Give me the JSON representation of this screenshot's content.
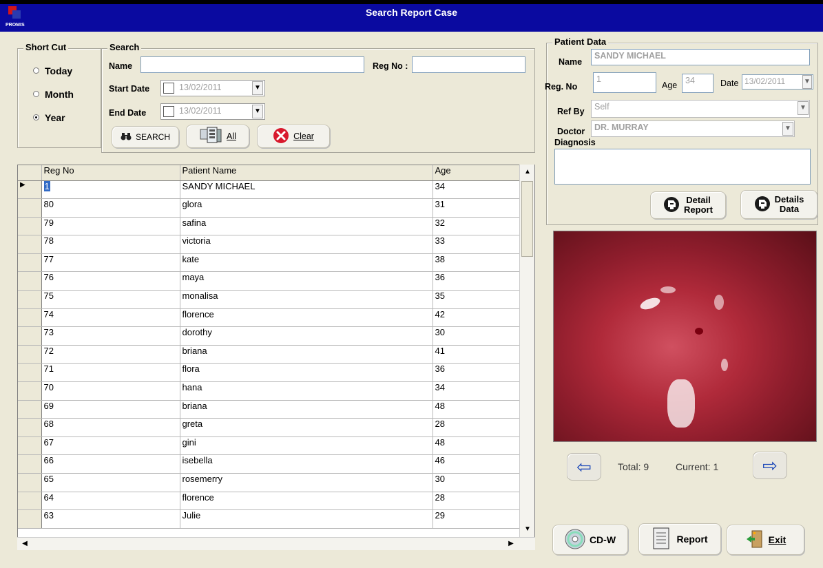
{
  "window": {
    "title": "Search Report Case",
    "logo_text": "PROMIS"
  },
  "shortcut": {
    "label": "Short Cut",
    "options": [
      {
        "label": "Today",
        "selected": false
      },
      {
        "label": "Month",
        "selected": false
      },
      {
        "label": "Year",
        "selected": true
      }
    ]
  },
  "search": {
    "label": "Search",
    "name_label": "Name",
    "name_value": "",
    "regno_label": "Reg No :",
    "regno_value": "",
    "start_label": "Start Date",
    "start_value": "13/02/2011",
    "end_label": "End Date",
    "end_value": "13/02/2011",
    "btn_search": "SEARCH",
    "btn_all": "All",
    "btn_clear": "Clear"
  },
  "grid": {
    "columns": [
      "Reg No",
      "Patient Name",
      "Age"
    ],
    "rows": [
      [
        "1",
        "SANDY MICHAEL",
        "34"
      ],
      [
        "80",
        "glora",
        "31"
      ],
      [
        "79",
        "safina",
        "32"
      ],
      [
        "78",
        "victoria",
        "33"
      ],
      [
        "77",
        "kate",
        "38"
      ],
      [
        "76",
        "maya",
        "36"
      ],
      [
        "75",
        "monalisa",
        "35"
      ],
      [
        "74",
        "florence",
        "42"
      ],
      [
        "73",
        "dorothy",
        "30"
      ],
      [
        "72",
        "briana",
        "41"
      ],
      [
        "71",
        "flora",
        "36"
      ],
      [
        "70",
        "hana",
        "34"
      ],
      [
        "69",
        "briana",
        "48"
      ],
      [
        "68",
        "greta",
        "28"
      ],
      [
        "67",
        "gini",
        "48"
      ],
      [
        "66",
        "isebella",
        "46"
      ],
      [
        "65",
        "rosemerry",
        "30"
      ],
      [
        "64",
        "florence",
        "28"
      ],
      [
        "63",
        "Julie",
        "29"
      ]
    ]
  },
  "patient": {
    "label": "Patient Data",
    "name_label": "Name",
    "name_value": "SANDY MICHAEL",
    "regno_label": "Reg. No",
    "regno_value": "1",
    "age_label": "Age",
    "age_value": "34",
    "date_label": "Date",
    "date_value": "13/02/2011",
    "refby_label": "Ref By",
    "refby_value": "Self",
    "doctor_label": "Doctor",
    "doctor_value": "DR. MURRAY",
    "diagnosis_label": "Diagnosis",
    "diagnosis_value": "",
    "btn_detail_report_1": "Detail",
    "btn_detail_report_2": "Report",
    "btn_details_data_1": "Details",
    "btn_details_data_2": "Data"
  },
  "viewer": {
    "total_text": "Total: 9",
    "current_text": "Current: 1"
  },
  "bottom": {
    "cdw": "CD-W",
    "report": "Report",
    "exit": "Exit"
  }
}
